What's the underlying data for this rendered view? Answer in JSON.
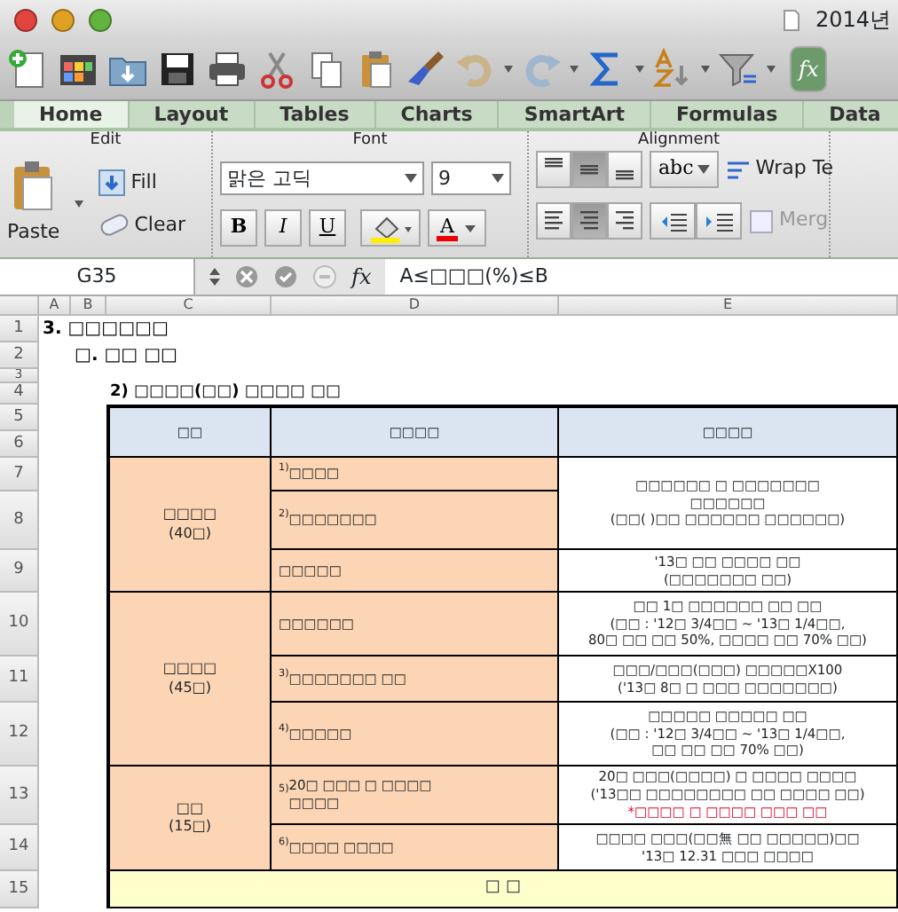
{
  "window": {
    "title": "2014년"
  },
  "ribbon_tabs": [
    {
      "label": "Home",
      "selected": true
    },
    {
      "label": "Layout",
      "selected": false
    },
    {
      "label": "Tables",
      "selected": false
    },
    {
      "label": "Charts",
      "selected": false
    },
    {
      "label": "SmartArt",
      "selected": false
    },
    {
      "label": "Formulas",
      "selected": false
    },
    {
      "label": "Data",
      "selected": false
    }
  ],
  "edit": {
    "title": "Edit",
    "paste": "Paste",
    "fill": "Fill",
    "clear": "Clear"
  },
  "font": {
    "title": "Font",
    "name": "맑은 고딕",
    "size": "9",
    "bold": "B",
    "italic": "I",
    "underline": "U",
    "color_letter": "A"
  },
  "alignment": {
    "title": "Alignment",
    "vertical": [
      {
        "selected": false
      },
      {
        "selected": true
      },
      {
        "selected": false
      }
    ],
    "horizontal": [
      {
        "selected": false
      },
      {
        "selected": true
      },
      {
        "selected": false
      }
    ],
    "format": "abc",
    "wrap_text": "Wrap Te",
    "merge": {
      "label": "Merg",
      "disabled": true
    }
  },
  "formula_bar": {
    "cell": "G35",
    "function_label": "fx",
    "formula": "A≤□□□(%)≤B"
  },
  "toolbar": {
    "function_label": "fx"
  },
  "columns": [
    "A",
    "B",
    "C",
    "D",
    "E"
  ],
  "rows": [
    "1",
    "2",
    "3",
    "4",
    "5",
    "6",
    "7",
    "8",
    "9",
    "10",
    "11",
    "12",
    "13",
    "14",
    "15"
  ],
  "sheet": {
    "heading": "3. □□□□□□",
    "subheading": "□. □□ □□",
    "table_title": "2) □□□□(□□) □□□□ □□",
    "header": [
      "□□",
      "□□□□",
      "□□□□"
    ],
    "groups": [
      {
        "name": "□□□□\n(40□)",
        "items": [
          {
            "label": "$^{1)}$□□□□",
            "criteria": {
              "lines": [
                "□□□□□□ □ □□□□□□□",
                "□□□□□□",
                "(□□( )□□ □□□□□□ □□□□□□)"
              ]
            }
          },
          {
            "label": "$^{2)}$□□□□□□□"
          },
          {
            "label": "□□□□□",
            "criteria": {
              "lines": [
                "'13□ □□ □□□□ □□",
                "(□□□□□□□ □□)"
              ]
            }
          }
        ]
      },
      {
        "name": "□□□□\n(45□)",
        "items": [
          {
            "label": "□□□□□□",
            "criteria": {
              "lines": [
                "□□ 1□ □□□□□□ □□ □□",
                "(□□ : '12□ 3/4□□ ~ '13□ 1/4□□,",
                "80□ □□ □□ 50%, □□□□ □□ 70% □□)"
              ]
            }
          },
          {
            "label": "$^{3)}$□□□□□□□ □□",
            "criteria": {
              "lines": [
                "□□□/□□□(□□□) □□□□□X100",
                "('13□ 8□ □ □□□ □□□□□□□)"
              ]
            }
          },
          {
            "label": "$^{4)}$□□□□□",
            "criteria": {
              "lines": [
                "□□□□□ □□□□□ □□",
                "(□□ : '12□ 3/4□□ ~ '13□ 1/4□□,",
                "□□ □□ □□ 70% □□)"
              ]
            }
          }
        ]
      },
      {
        "name": "□□\n(15□)",
        "items": [
          {
            "label": "$^{5)}$20□ □□□ □ □□□□\n□□□□",
            "criteria": {
              "lines": [
                "20□ □□□(□□□□) □ □□□□ □□□□",
                "('13□□ □□□□□□□□ □□ □□□□ □□)"
              ],
              "warning": "*□□□□ □ □□□□ □□□ □□"
            }
          },
          {
            "label": "$^{6)}$□□□□ □□□□",
            "criteria": {
              "lines": [
                "□□□□ □□□(□□無 □□ □□□□□)□□",
                "'13□ 12.31 □□□ □□□□"
              ]
            }
          }
        ]
      }
    ],
    "footer": "□ □"
  }
}
